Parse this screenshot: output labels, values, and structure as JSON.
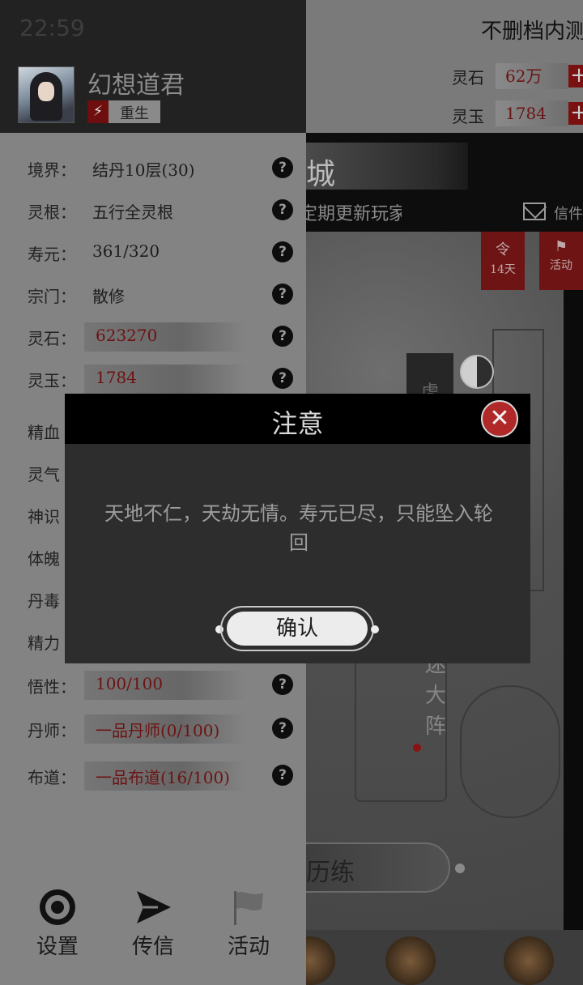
{
  "status_bar": {
    "time": "22:59"
  },
  "header": {
    "notice": "不删档内测",
    "resources": [
      {
        "label": "灵石",
        "value": "62万",
        "add": "+"
      },
      {
        "label": "灵玉",
        "value": "1784",
        "add": "+"
      }
    ]
  },
  "city": {
    "title": "城",
    "ticker": "定期更新玩家",
    "mail_label": "信件",
    "banners": [
      {
        "icon": "令",
        "label": "14天"
      },
      {
        "icon": "⚑",
        "label": "活动"
      }
    ],
    "map_labels": {
      "tiger": "虎",
      "formation": [
        "迷",
        "大",
        "阵"
      ]
    },
    "train_button": "历练"
  },
  "player": {
    "name": "幻想道君",
    "badge_icon": "⚡",
    "badge_label": "重生"
  },
  "stats": [
    {
      "label": "境界：",
      "value": "结丹10层(30)",
      "style": "plain"
    },
    {
      "label": "灵根：",
      "value": "五行全灵根",
      "style": "plain"
    },
    {
      "label": "寿元：",
      "value": "361/320",
      "style": "plain"
    },
    {
      "label": "宗门：",
      "value": "散修",
      "style": "plain"
    },
    {
      "label": "灵石：",
      "value": "623270",
      "style": "red"
    },
    {
      "label": "灵玉：",
      "value": "1784",
      "style": "red"
    },
    {
      "label": "精血",
      "value": "",
      "style": "hidden"
    },
    {
      "label": "灵气",
      "value": "",
      "style": "hidden"
    },
    {
      "label": "神识",
      "value": "",
      "style": "hidden"
    },
    {
      "label": "体魄",
      "value": "",
      "style": "hidden"
    },
    {
      "label": "丹毒",
      "value": "",
      "style": "hidden"
    },
    {
      "label": "精力",
      "value": "",
      "style": "hidden"
    },
    {
      "label": "悟性：",
      "value": "100/100",
      "style": "red"
    },
    {
      "label": "丹师：",
      "value": "一品丹师(0/100)",
      "style": "red"
    },
    {
      "label": "布道：",
      "value": "一品布道(16/100)",
      "style": "red"
    }
  ],
  "help_symbol": "?",
  "bottom_nav": [
    {
      "label": "设置",
      "icon": "gear-icon"
    },
    {
      "label": "传信",
      "icon": "paper-plane-icon"
    },
    {
      "label": "活动",
      "icon": "flag-icon"
    }
  ],
  "dialog": {
    "title": "注意",
    "close_symbol": "✕",
    "message": "天地不仁，天劫无情。寿元已尽，只能坠入轮回",
    "confirm_label": "确认"
  },
  "colors": {
    "accent_red": "#6d1313",
    "dialog_bg": "#2d2d2d",
    "dialog_header": "#000000",
    "panel_bg": "#838383"
  }
}
